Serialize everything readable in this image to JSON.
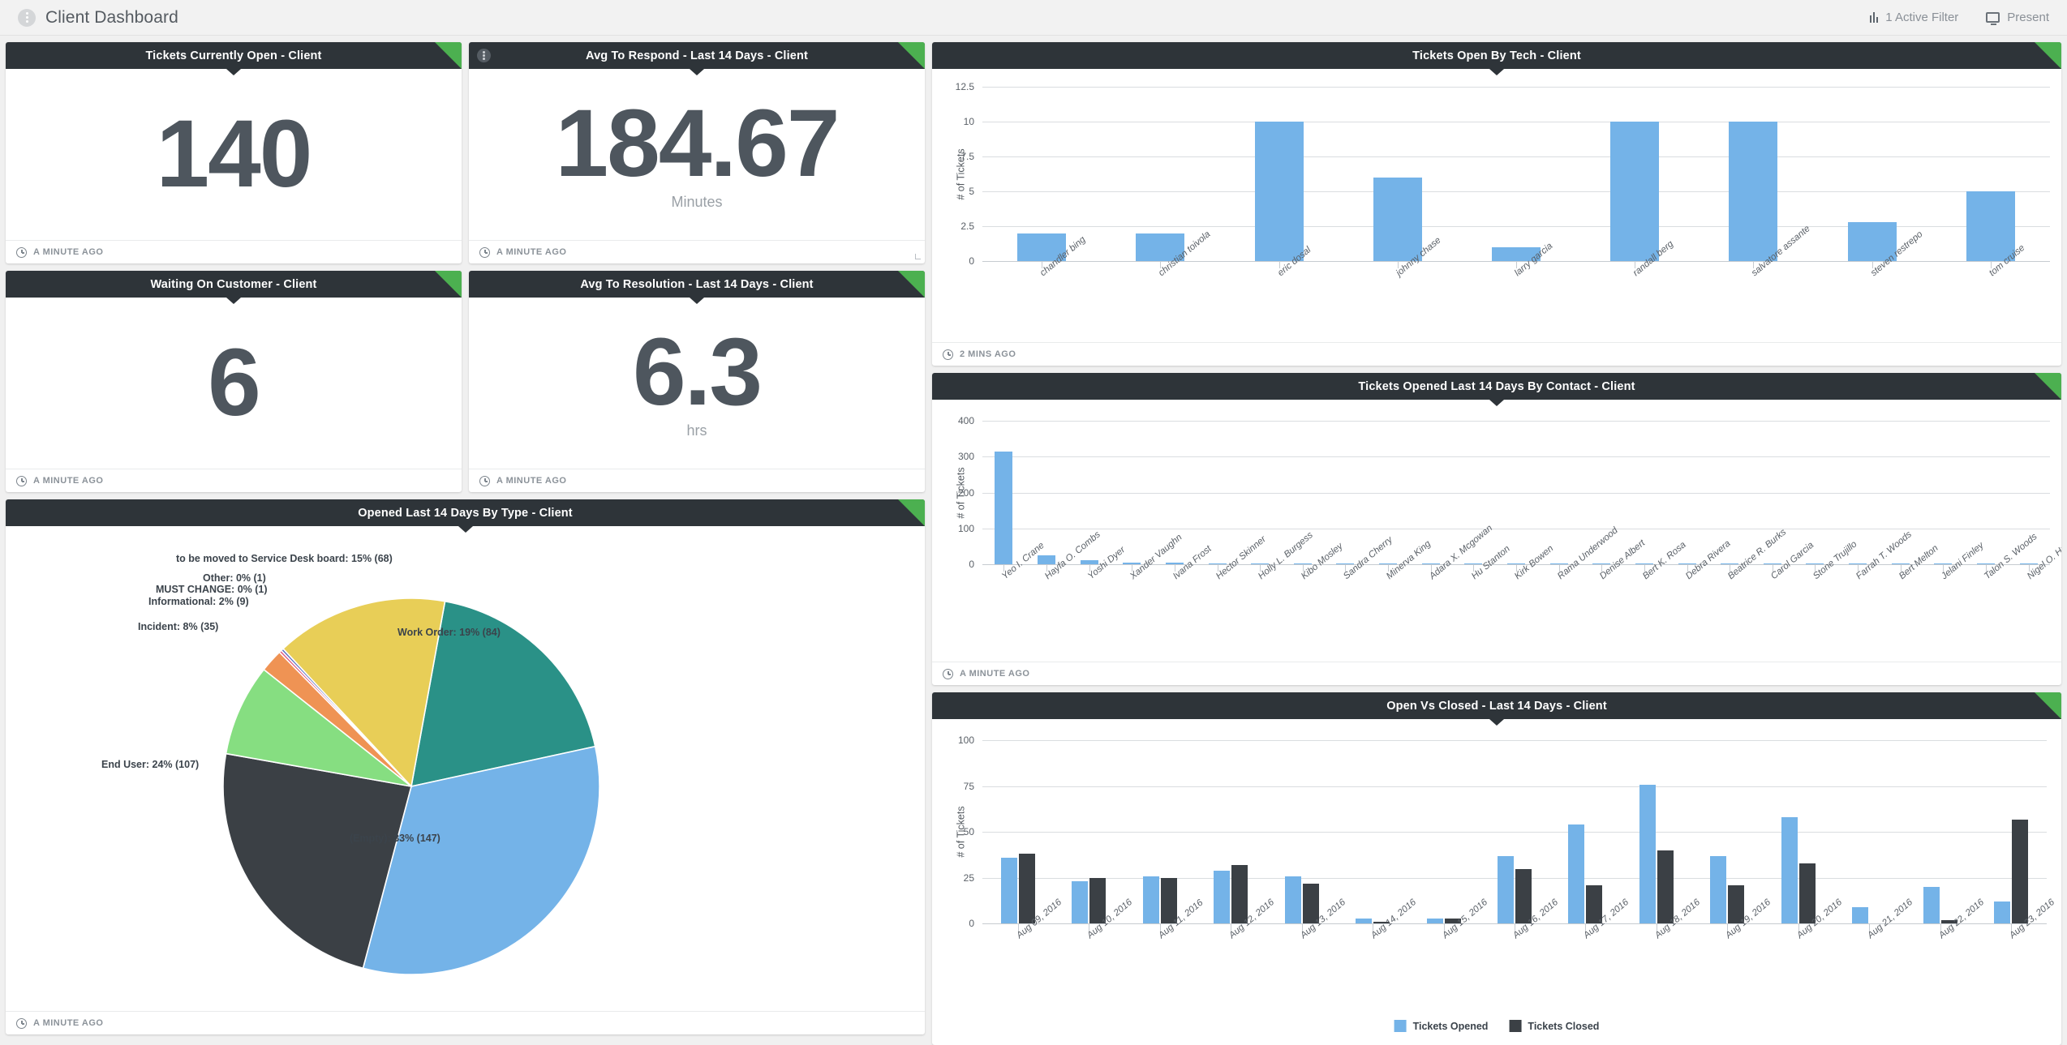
{
  "header": {
    "title": "Client Dashboard",
    "kebab_icon": "kebab-menu-icon",
    "active_filter": "1 Active Filter",
    "filter_icon": "sliders-icon",
    "present": "Present",
    "present_icon": "monitor-icon"
  },
  "kpis": [
    {
      "title": "Tickets Currently Open - Client",
      "value": "140",
      "unit": "",
      "timestamp": "A MINUTE AGO",
      "has_kebab": false,
      "has_grip": false
    },
    {
      "title": "Avg To Respond - Last 14 Days - Client",
      "value": "184.67",
      "unit": "Minutes",
      "timestamp": "A MINUTE AGO",
      "has_kebab": true,
      "has_grip": true
    },
    {
      "title": "Waiting On Customer - Client",
      "value": "6",
      "unit": "",
      "timestamp": "A MINUTE AGO",
      "has_kebab": false,
      "has_grip": false
    },
    {
      "title": "Avg To Resolution - Last 14 Days - Client",
      "value": "6.3",
      "unit": "hrs",
      "timestamp": "A MINUTE AGO",
      "has_kebab": false,
      "has_grip": false
    }
  ],
  "panels": {
    "pie": {
      "title": "Opened Last 14 Days By Type - Client",
      "timestamp": "A MINUTE AGO"
    },
    "tech": {
      "title": "Tickets Open By Tech - Client",
      "timestamp": "2 MINS AGO"
    },
    "contact": {
      "title": "Tickets Opened Last 14 Days By Contact - Client",
      "timestamp": "A MINUTE AGO"
    },
    "openclosed": {
      "title": "Open Vs Closed - Last 14 Days - Client",
      "timestamp": ""
    }
  },
  "colors": {
    "accent_green": "#4cb050",
    "header_dark": "#2e3439",
    "bar_blue": "#74b3e8",
    "bar_dark": "#3b4045",
    "kpi_text": "#4e565e"
  },
  "chart_data": [
    {
      "type": "pie",
      "title": "Opened Last 14 Days By Type - Client",
      "legend": "labels-on-slices",
      "slices": [
        {
          "label": "Work Order",
          "pct": "19%",
          "count": 84,
          "value": 19,
          "color": "#2a9187"
        },
        {
          "label": "(Empty)",
          "pct": "33%",
          "count": 147,
          "value": 33,
          "color": "#74b3e8"
        },
        {
          "label": "End User",
          "pct": "24%",
          "count": 107,
          "value": 24,
          "color": "#3b4045"
        },
        {
          "label": "Incident",
          "pct": "8%",
          "count": 35,
          "value": 8,
          "color": "#86de81"
        },
        {
          "label": "Informational",
          "pct": "2%",
          "count": 9,
          "value": 2,
          "color": "#ef9354"
        },
        {
          "label": "MUST CHANGE",
          "pct": "0%",
          "count": 1,
          "value": 0.22,
          "color": "#e0527c"
        },
        {
          "label": "Other",
          "pct": "0%",
          "count": 1,
          "value": 0.22,
          "color": "#5b6ebe"
        },
        {
          "label": "to be moved to Service Desk board",
          "pct": "15%",
          "count": 68,
          "value": 15,
          "color": "#e8ce57"
        }
      ],
      "labels": [
        "to be moved to Service Desk board: 15% (68)",
        "Other: 0% (1)",
        "MUST CHANGE: 0% (1)",
        "Informational: 2% (9)",
        "Incident: 8% (35)",
        "End User: 24% (107)",
        "(Empty): 33% (147)",
        "Work Order: 19% (84)"
      ]
    },
    {
      "type": "bar",
      "title": "Tickets Open By Tech - Client",
      "xlabel": "",
      "ylabel": "# of Tickets",
      "ylim": [
        0,
        12.5
      ],
      "yticks": [
        0,
        2.5,
        5,
        7.5,
        10,
        12.5
      ],
      "ytick_labels": [
        "0",
        "2.5",
        "5",
        "7.5",
        "10",
        "12.5"
      ],
      "categories": [
        "chandler bing",
        "christian toivola",
        "eric dosal",
        "johnny chase",
        "larry garcia",
        "randall berg",
        "salvatore assante",
        "steven restrepo",
        "tom cruise"
      ],
      "values": [
        2,
        2,
        10,
        6,
        1,
        10,
        10,
        2.8,
        5
      ],
      "grid": true
    },
    {
      "type": "bar",
      "title": "Tickets Opened Last 14 Days By Contact - Client",
      "xlabel": "",
      "ylabel": "# of Tickets",
      "ylim": [
        0,
        400
      ],
      "yticks": [
        0,
        100,
        200,
        300,
        400
      ],
      "ytick_labels": [
        "0",
        "100",
        "200",
        "300",
        "400"
      ],
      "categories": [
        "Yeo I. Crane",
        "Hayfa O. Combs",
        "Yoshi Dyer",
        "Xander Vaughn",
        "Ivana Frost",
        "Hector Skinner",
        "Holly L. Burgess",
        "Kibo Mosley",
        "Sandra Cherry",
        "Minerva King",
        "Adara X. Mcgowan",
        "Hu Stanton",
        "Kirk Bowen",
        "Rama Underwood",
        "Denise Albert",
        "Bert K. Rosa",
        "Debra Rivera",
        "Beatrice R. Burks",
        "Carol Garcia",
        "Stone Trujillo",
        "Farrah T. Woods",
        "Bert Melton",
        "Jelani Finley",
        "Talon S. Woods",
        "Nigel O. Hull"
      ],
      "values": [
        315,
        26,
        12,
        5,
        5,
        3,
        3,
        3,
        3,
        3,
        3,
        1,
        1,
        1,
        1,
        1,
        1,
        1,
        1,
        1,
        1,
        1,
        1,
        1,
        1
      ],
      "grid": true
    },
    {
      "type": "bar",
      "title": "Open Vs Closed - Last 14 Days - Client",
      "xlabel": "",
      "ylabel": "# of Tickets",
      "ylim": [
        0,
        100
      ],
      "yticks": [
        0,
        25,
        50,
        75,
        100
      ],
      "ytick_labels": [
        "0",
        "25",
        "50",
        "75",
        "100"
      ],
      "categories": [
        "Aug 09, 2016",
        "Aug 10, 2016",
        "Aug 11, 2016",
        "Aug 12, 2016",
        "Aug 13, 2016",
        "Aug 14, 2016",
        "Aug 15, 2016",
        "Aug 16, 2016",
        "Aug 17, 2016",
        "Aug 18, 2016",
        "Aug 19, 2016",
        "Aug 20, 2016",
        "Aug 21, 2016",
        "Aug 22, 2016",
        "Aug 23, 2016"
      ],
      "series": [
        {
          "name": "Tickets Opened",
          "color": "#74b3e8",
          "values": [
            36,
            23,
            26,
            29,
            26,
            3,
            3,
            37,
            54,
            76,
            37,
            58,
            9,
            20,
            12
          ]
        },
        {
          "name": "Tickets Closed",
          "color": "#3b4045",
          "values": [
            38,
            25,
            25,
            32,
            22,
            1,
            3,
            30,
            21,
            40,
            21,
            33,
            0,
            2,
            57
          ]
        }
      ],
      "grid": true,
      "legend_position": "bottom-center"
    }
  ]
}
